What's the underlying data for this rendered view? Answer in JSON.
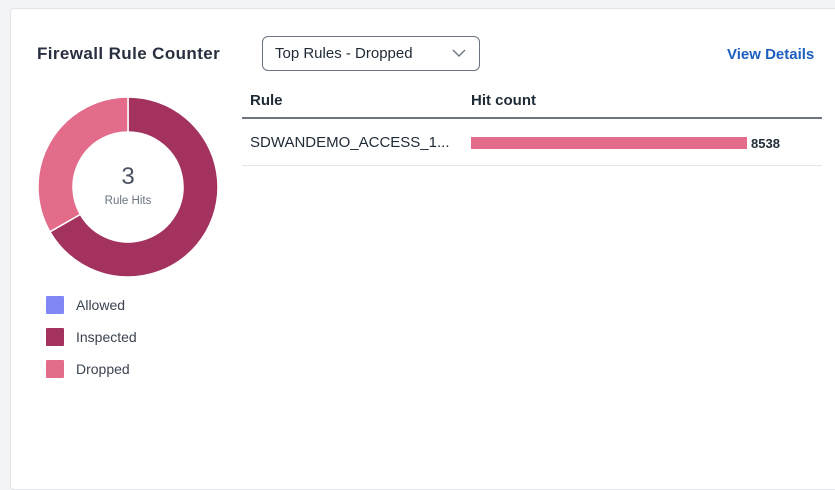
{
  "widget": {
    "title": "Firewall Rule Counter",
    "view_details_label": "View Details"
  },
  "dropdown": {
    "selected": "Top Rules - Dropped",
    "icon": "chevron-down-icon"
  },
  "donut": {
    "total": "3",
    "label": "Rule Hits",
    "segments": [
      {
        "name": "Allowed",
        "fraction": 0.0,
        "color": "#8187f5"
      },
      {
        "name": "Inspected",
        "fraction": 0.667,
        "color": "#a3325f"
      },
      {
        "name": "Dropped",
        "fraction": 0.333,
        "color": "#e26c8a"
      }
    ]
  },
  "legend": [
    {
      "label": "Allowed",
      "color": "#8187f5"
    },
    {
      "label": "Inspected",
      "color": "#a3325f"
    },
    {
      "label": "Dropped",
      "color": "#e26c8a"
    }
  ],
  "table": {
    "headers": {
      "rule": "Rule",
      "hits": "Hit count"
    },
    "rows": [
      {
        "rule": "SDWANDEMO_ACCESS_1...",
        "hits": "8538",
        "bar_fraction": 1.0,
        "bar_color": "#e26c8a"
      }
    ]
  }
}
